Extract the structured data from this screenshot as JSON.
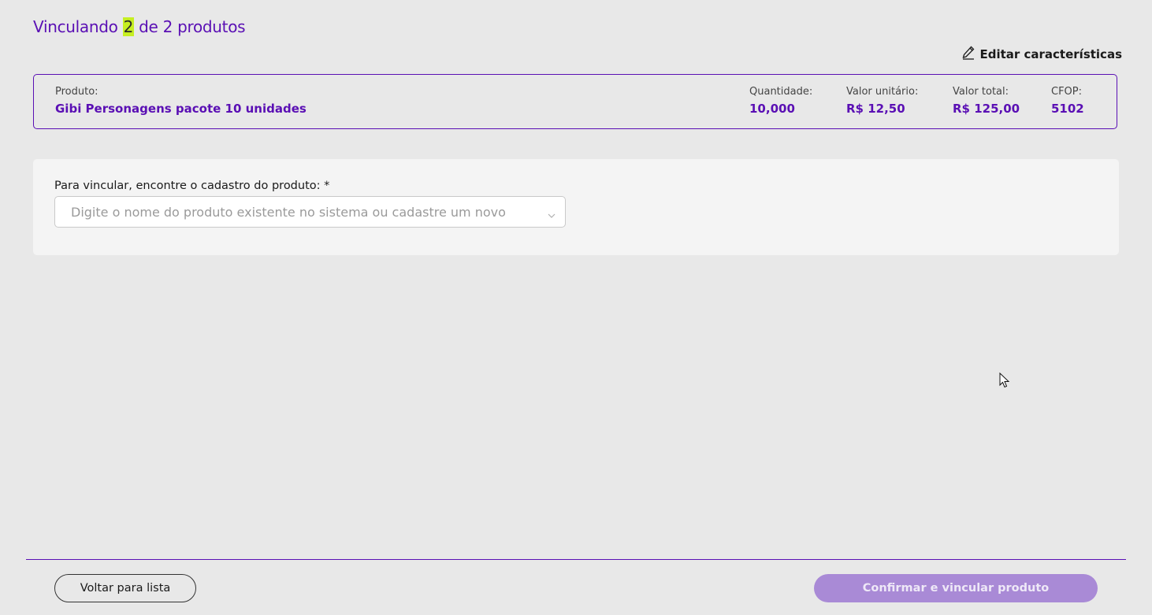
{
  "header": {
    "title_prefix": "Vinculando",
    "current": "2",
    "title_suffix": "de 2 produtos",
    "edit_label": "Editar características"
  },
  "product": {
    "name_label": "Produto:",
    "name": "Gibi Personagens pacote 10 unidades",
    "quantity_label": "Quantidade:",
    "quantity": "10,000",
    "unit_value_label": "Valor unitário:",
    "unit_value": "R$ 12,50",
    "total_value_label": "Valor total:",
    "total_value": "R$ 125,00",
    "cfop_label": "CFOP:",
    "cfop": "5102"
  },
  "search": {
    "label": "Para vincular, encontre o cadastro do produto: *",
    "placeholder": "Digite o nome do produto existente no sistema ou cadastre um novo",
    "value": ""
  },
  "footer": {
    "back_label": "Voltar para lista",
    "confirm_label": "Confirmar e vincular produto"
  },
  "icons": {
    "edit": "pencil-icon",
    "dropdown": "chevron-down-icon",
    "cursor": "mouse-pointer-icon"
  },
  "colors": {
    "accent": "#5a0fb4",
    "highlight": "#c6ef22",
    "confirm_disabled": "#a98ad6",
    "background": "#e8e8e8"
  }
}
